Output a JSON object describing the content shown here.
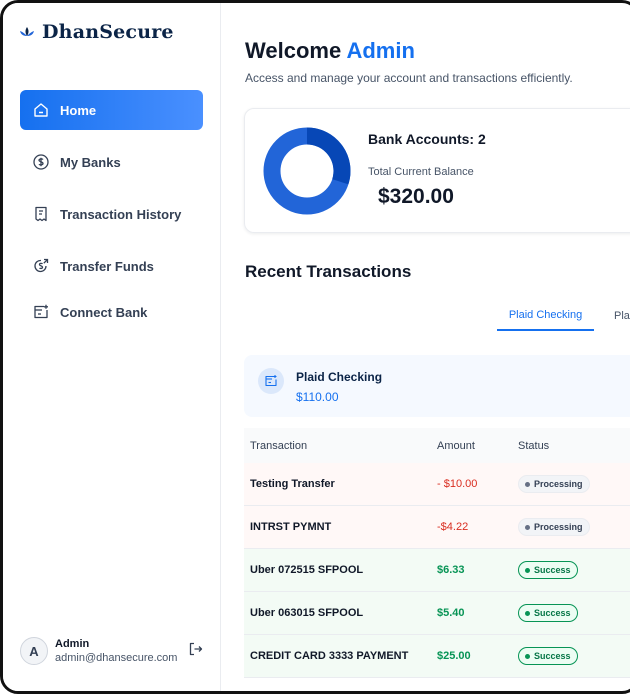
{
  "brand": {
    "name": "DhanSecure",
    "logo": "lotus-logo-icon",
    "color": "#0b2447"
  },
  "sidebar": {
    "items": [
      {
        "label": "Home",
        "icon": "home-icon",
        "active": true
      },
      {
        "label": "My Banks",
        "icon": "dollar-circle-icon",
        "active": false
      },
      {
        "label": "Transaction History",
        "icon": "receipt-icon",
        "active": false
      },
      {
        "label": "Transfer Funds",
        "icon": "money-send-icon",
        "active": false
      },
      {
        "label": "Connect Bank",
        "icon": "connect-bank-icon",
        "active": false
      }
    ],
    "accent": "#1570ef"
  },
  "user": {
    "initial": "A",
    "name": "Admin",
    "email": "admin@dhansecure.com",
    "logout_icon": "logout-icon"
  },
  "header": {
    "greeting": "Welcome",
    "name": "Admin",
    "subtitle": "Access and manage your account and transactions efficiently."
  },
  "balance": {
    "bank_accounts_label": "Bank Accounts: 2",
    "total_label": "Total Current Balance",
    "total_value": "$320.00"
  },
  "recent": {
    "title": "Recent Transactions",
    "tabs": [
      {
        "label": "Plaid Checking",
        "active": true
      },
      {
        "label": "Pla",
        "active": false
      }
    ],
    "bank_info": {
      "name": "Plaid Checking",
      "amount": "$110.00",
      "icon": "bank-card-icon"
    },
    "columns": [
      "Transaction",
      "Amount",
      "Status"
    ],
    "rows": [
      {
        "name": "Testing Transfer",
        "amount": "- $10.00",
        "status": "Processing",
        "type": "debit"
      },
      {
        "name": "INTRST PYMNT",
        "amount": "-$4.22",
        "status": "Processing",
        "type": "debit"
      },
      {
        "name": "Uber 072515 SFPOOL",
        "amount": "$6.33",
        "status": "Success",
        "type": "credit"
      },
      {
        "name": "Uber 063015 SFPOOL",
        "amount": "$5.40",
        "status": "Success",
        "type": "credit"
      },
      {
        "name": "CREDIT CARD 3333 PAYMENT",
        "amount": "$25.00",
        "status": "Success",
        "type": "credit"
      }
    ]
  },
  "colors": {
    "debit": "#d92d20",
    "credit": "#079455",
    "donut_primary": "#0747b6",
    "donut_secondary": "#2265d8"
  }
}
